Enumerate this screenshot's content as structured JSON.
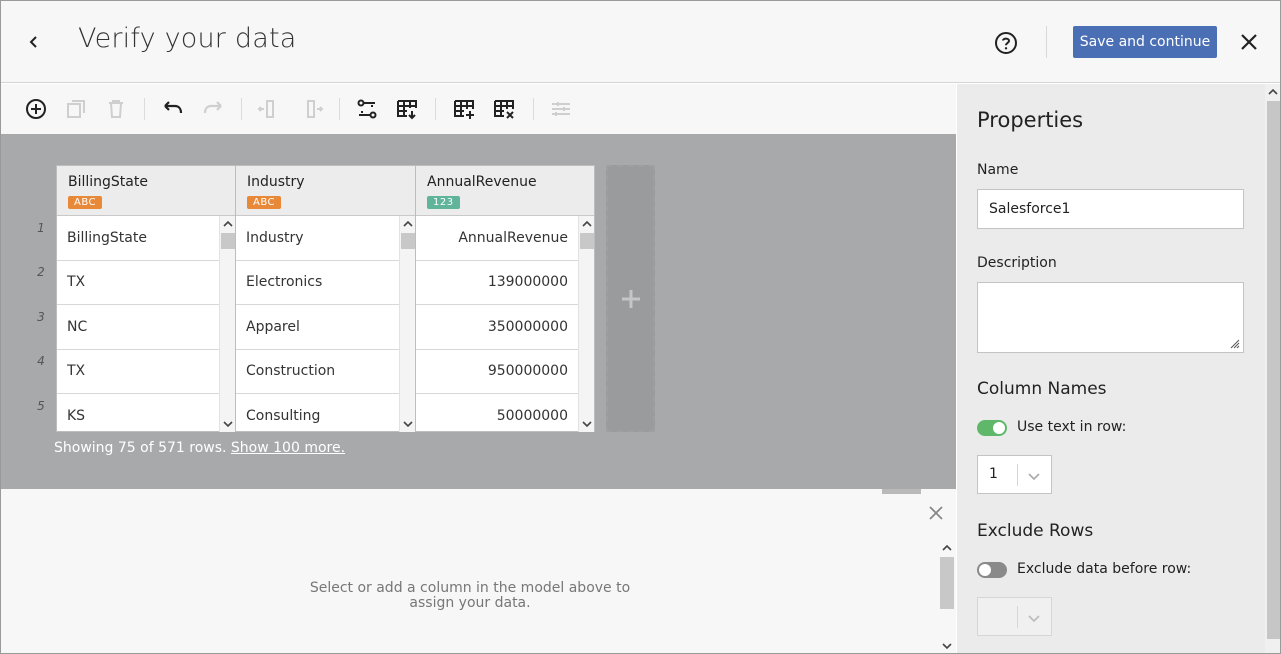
{
  "header": {
    "title": "Verify your data",
    "save_label": "Save and continue"
  },
  "icons": {
    "back": "chevron-left-icon",
    "help": "help-circle-icon",
    "close": "close-icon"
  },
  "toolbar": {
    "items": [
      {
        "name": "add-icon",
        "enabled": true
      },
      {
        "name": "duplicate-icon",
        "enabled": false
      },
      {
        "name": "delete-icon",
        "enabled": false
      },
      {
        "name": "undo-icon",
        "enabled": true
      },
      {
        "name": "redo-icon",
        "enabled": false
      },
      {
        "name": "move-column-left-icon",
        "enabled": false
      },
      {
        "name": "move-column-right-icon",
        "enabled": false
      },
      {
        "name": "relationship-icon",
        "enabled": true
      },
      {
        "name": "table-settings-icon",
        "enabled": true
      },
      {
        "name": "add-table-icon",
        "enabled": true
      },
      {
        "name": "remove-table-icon",
        "enabled": true
      },
      {
        "name": "filters-icon",
        "enabled": false
      }
    ]
  },
  "grid": {
    "row_numbers": [
      "1",
      "2",
      "3",
      "4",
      "5"
    ],
    "columns": [
      {
        "name": "BillingState",
        "type": "ABC",
        "align": "left",
        "cells": [
          "BillingState",
          "TX",
          "NC",
          "TX",
          "KS"
        ]
      },
      {
        "name": "Industry",
        "type": "ABC",
        "align": "left",
        "cells": [
          "Industry",
          "Electronics",
          "Apparel",
          "Construction",
          "Consulting"
        ]
      },
      {
        "name": "AnnualRevenue",
        "type": "123",
        "align": "right",
        "cells": [
          "AnnualRevenue",
          "139000000",
          "350000000",
          "950000000",
          "50000000"
        ]
      }
    ],
    "showing_text": "Showing 75 of 571 rows.",
    "show_more_label": "Show 100 more."
  },
  "bottom_panel": {
    "message": "Select or add a column in the model above to assign your data."
  },
  "properties": {
    "title": "Properties",
    "name_label": "Name",
    "name_value": "Salesforce1",
    "description_label": "Description",
    "column_names_title": "Column Names",
    "use_text_label": "Use text in row:",
    "use_text_on": true,
    "use_text_row": "1",
    "exclude_rows_title": "Exclude Rows",
    "exclude_label": "Exclude data before row:",
    "exclude_on": false
  },
  "colors": {
    "accent": "#4a6fb5",
    "toggle_on": "#5fb86a",
    "badge_text": "#e8893a",
    "badge_number": "#5fb49a"
  }
}
